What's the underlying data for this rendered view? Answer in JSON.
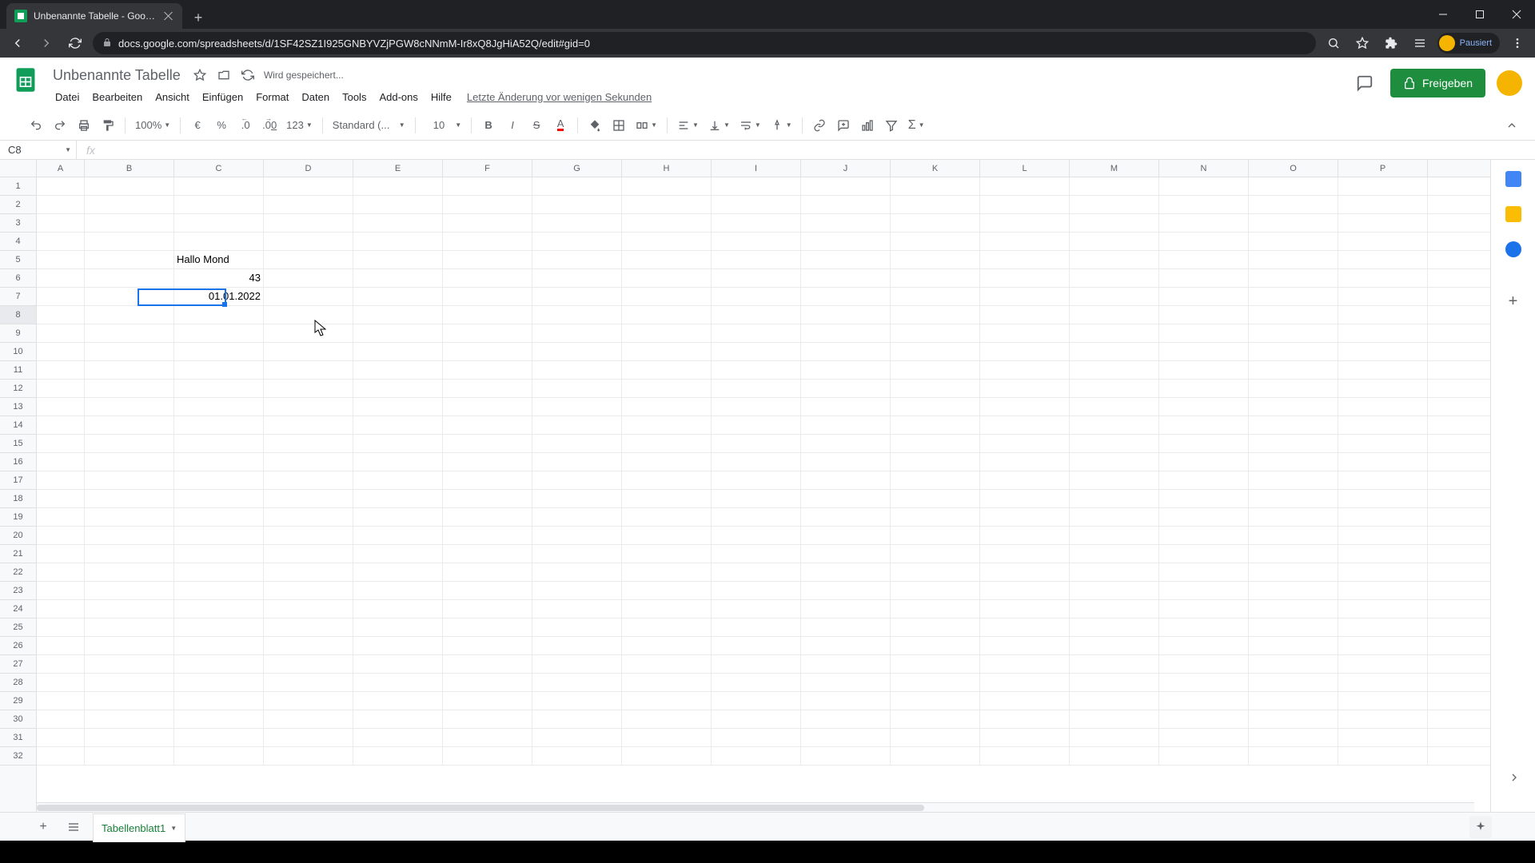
{
  "browser": {
    "tab_title": "Unbenannte Tabelle - Google Ta",
    "url": "docs.google.com/spreadsheets/d/1SF42SZ1I925GNBYVZjPGW8cNNmM-Ir8xQ8JgHiA52Q/edit#gid=0",
    "profile_status": "Pausiert"
  },
  "header": {
    "doc_title": "Unbenannte Tabelle",
    "save_status": "Wird gespeichert...",
    "last_edit": "Letzte Änderung vor wenigen Sekunden",
    "share_label": "Freigeben"
  },
  "menu": {
    "file": "Datei",
    "edit": "Bearbeiten",
    "view": "Ansicht",
    "insert": "Einfügen",
    "format": "Format",
    "data": "Daten",
    "tools": "Tools",
    "addons": "Add-ons",
    "help": "Hilfe"
  },
  "toolbar": {
    "zoom": "100%",
    "currency": "€",
    "percent": "%",
    "dec_dec": ".0",
    "inc_dec": ".00",
    "num_format": "123",
    "font": "Standard (...",
    "font_size": "10"
  },
  "name_box": "C8",
  "columns": [
    "A",
    "B",
    "C",
    "D",
    "E",
    "F",
    "G",
    "H",
    "I",
    "J",
    "K",
    "L",
    "M",
    "N",
    "O",
    "P"
  ],
  "row_count": 32,
  "selected_row": 8,
  "cells": {
    "C5": "Hallo Mond",
    "C6": "43",
    "C7": "01.01.2022"
  },
  "sheet_tab": "Tabellenblatt1"
}
